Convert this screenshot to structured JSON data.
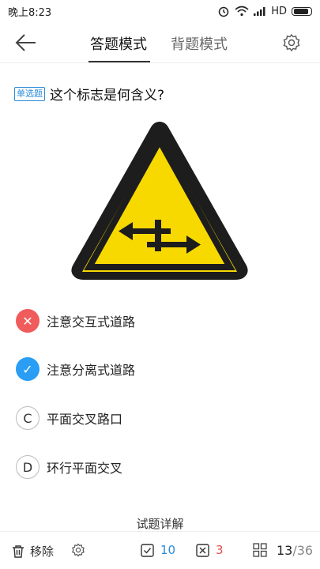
{
  "status_bar": {
    "time": "晚上8:23",
    "network": "HD"
  },
  "header": {
    "tab_answer": "答题模式",
    "tab_recite": "背题模式"
  },
  "question": {
    "type_badge": "单选题",
    "text": "这个标志是何含义?"
  },
  "options": [
    {
      "marker": "✕",
      "state": "wrong",
      "text": "注意交互式道路"
    },
    {
      "marker": "✓",
      "state": "correct",
      "text": "注意分离式道路"
    },
    {
      "marker": "C",
      "state": "none",
      "text": "平面交叉路口"
    },
    {
      "marker": "D",
      "state": "none",
      "text": "环行平面交叉"
    }
  ],
  "detail": {
    "title": "试题详解"
  },
  "bottom_bar": {
    "remove_label": "移除",
    "correct_count": "10",
    "wrong_count": "3",
    "current": "13",
    "total": "/36"
  },
  "colors": {
    "accent": "#2a9df4",
    "wrong": "#f05b5b",
    "sign_yellow": "#f7d900"
  }
}
